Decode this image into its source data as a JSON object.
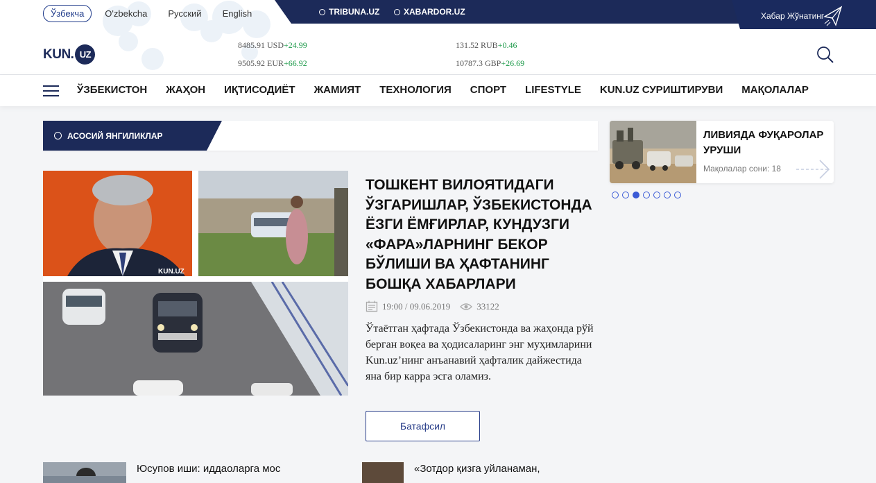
{
  "languages": [
    "Ўзбекча",
    "O'zbekcha",
    "Русский",
    "English"
  ],
  "partners": [
    "TRIBUNA.UZ",
    "XABARDOR.UZ"
  ],
  "send_news_label": "Хабар Жўнатинг",
  "logo": {
    "kun": "KUN.",
    "uz": "UZ"
  },
  "rates": [
    {
      "value": "8485.91 USD",
      "change": "+24.99"
    },
    {
      "value": "9505.92 EUR",
      "change": "+66.92"
    },
    {
      "value": "131.52 RUB",
      "change": "+0.46"
    },
    {
      "value": "10787.3 GBP",
      "change": "+26.69"
    }
  ],
  "nav": [
    "ЎЗБЕКИСТОН",
    "ЖАҲОН",
    "ИҚТИСОДИЁТ",
    "ЖАМИЯТ",
    "ТЕХНОЛОГИЯ",
    "СПОРТ",
    "LIFESTYLE",
    "KUN.UZ СУРИШТИРУВИ",
    "МАҚОЛАЛАР"
  ],
  "section_title": "АСОСИЙ ЯНГИЛИКЛАР",
  "main_article": {
    "title": "ТОШКЕНТ ВИЛОЯТИДАГИ ЎЗГАРИШЛАР, ЎЗБЕКИСТОНДА ЁЗГИ ЁМҒИРЛАР, КУНДУЗГИ «ФАРА»ЛАРНИНГ БЕКОР БЎЛИШИ ВА ҲАФТАНИНГ БОШҚА ХАБАРЛАРИ",
    "datetime": "19:00 / 09.06.2019",
    "views": "33122",
    "lead": "Ўтаётган ҳафтада Ўзбекистонда ва жаҳонда рўй берган воқеа ва ҳодисаларинг энг муҳимларини Kun.uz’нинг анъанавий ҳафталик дайжестида яна бир карра эсга оламиз.",
    "more_label": "Батафсил",
    "watermark": "KUN.UZ"
  },
  "side_card": {
    "title": "ЛИВИЯДА ФУҚАРОЛАР УРУШИ",
    "count": "Мақолалар сони: 18"
  },
  "slider": {
    "total": 7,
    "active": 3
  },
  "bottom": [
    {
      "text": "Юсупов иши: иддаоларга мос"
    },
    {
      "text": "«Зотдор қизга уйланаман,"
    }
  ],
  "colors": {
    "brand": "#1c2a59",
    "accent": "#3b5bd6",
    "positive": "#1d9a4a"
  }
}
